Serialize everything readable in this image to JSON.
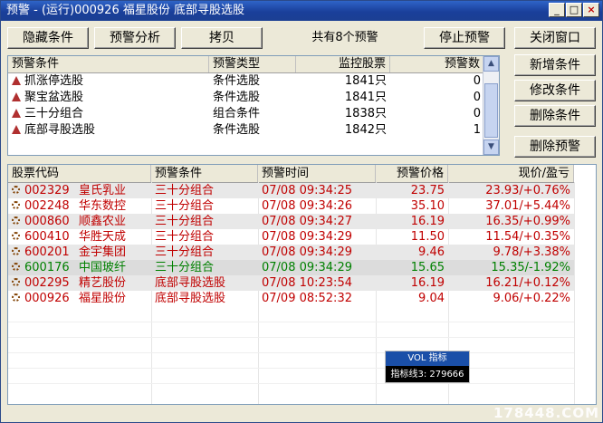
{
  "window": {
    "title": "预警 - (运行)000926 福星股份 底部寻股选股",
    "minimize_glyph": "_",
    "restore_glyph": "□",
    "close_glyph": "×"
  },
  "toolbar": {
    "hide_conditions": "隐藏条件",
    "alert_analysis": "预警分析",
    "copy": "拷贝",
    "count_text": "共有8个预警",
    "stop_alert": "停止预警",
    "close_window": "关闭窗口"
  },
  "side": {
    "add_condition": "新增条件",
    "modify_condition": "修改条件",
    "delete_condition": "删除条件",
    "delete_alert": "删除预警"
  },
  "conditions": {
    "headers": [
      "预警条件",
      "预警类型",
      "监控股票",
      "预警数"
    ],
    "rows": [
      {
        "name": "抓涨停选股",
        "type": "条件选股",
        "monitor": "1841只",
        "count": "0"
      },
      {
        "name": "聚宝盆选股",
        "type": "条件选股",
        "monitor": "1841只",
        "count": "0"
      },
      {
        "name": "三十分组合",
        "type": "组合条件",
        "monitor": "1838只",
        "count": "0"
      },
      {
        "name": "底部寻股选股",
        "type": "条件选股",
        "monitor": "1842只",
        "count": "1"
      }
    ]
  },
  "alerts": {
    "headers": [
      "股票代码",
      "预警条件",
      "预警时间",
      "预警价格",
      "现价/盈亏"
    ],
    "rows": [
      {
        "code": "002329",
        "name": "皇氏乳业",
        "cond": "三十分组合",
        "time": "07/08  09:34:25",
        "price": "23.75",
        "now": "23.93/+0.76%",
        "color": "#c00000"
      },
      {
        "code": "002248",
        "name": "华东数控",
        "cond": "三十分组合",
        "time": "07/08  09:34:26",
        "price": "35.10",
        "now": "37.01/+5.44%",
        "color": "#c00000"
      },
      {
        "code": "000860",
        "name": "顺鑫农业",
        "cond": "三十分组合",
        "time": "07/08  09:34:27",
        "price": "16.19",
        "now": "16.35/+0.99%",
        "color": "#c00000"
      },
      {
        "code": "600410",
        "name": "华胜天成",
        "cond": "三十分组合",
        "time": "07/08  09:34:29",
        "price": "11.50",
        "now": "11.54/+0.35%",
        "color": "#c00000"
      },
      {
        "code": "600201",
        "name": "金宇集团",
        "cond": "三十分组合",
        "time": "07/08  09:34:29",
        "price": "9.46",
        "now": "9.78/+3.38%",
        "color": "#c00000"
      },
      {
        "code": "600176",
        "name": "中国玻纤",
        "cond": "三十分组合",
        "time": "07/08  09:34:29",
        "price": "15.65",
        "now": "15.35/-1.92%",
        "color": "#008000"
      },
      {
        "code": "002295",
        "name": "精艺股份",
        "cond": "底部寻股选股",
        "time": "07/08  10:23:54",
        "price": "16.19",
        "now": "16.21/+0.12%",
        "color": "#c00000"
      },
      {
        "code": "000926",
        "name": "福星股份",
        "cond": "底部寻股选股",
        "time": "07/09  08:52:32",
        "price": "9.04",
        "now": "9.06/+0.22%",
        "color": "#c00000"
      }
    ]
  },
  "tooltip": {
    "title": "VOL 指标",
    "value": "指标线3: 279666"
  },
  "watermark": "178448.COM"
}
